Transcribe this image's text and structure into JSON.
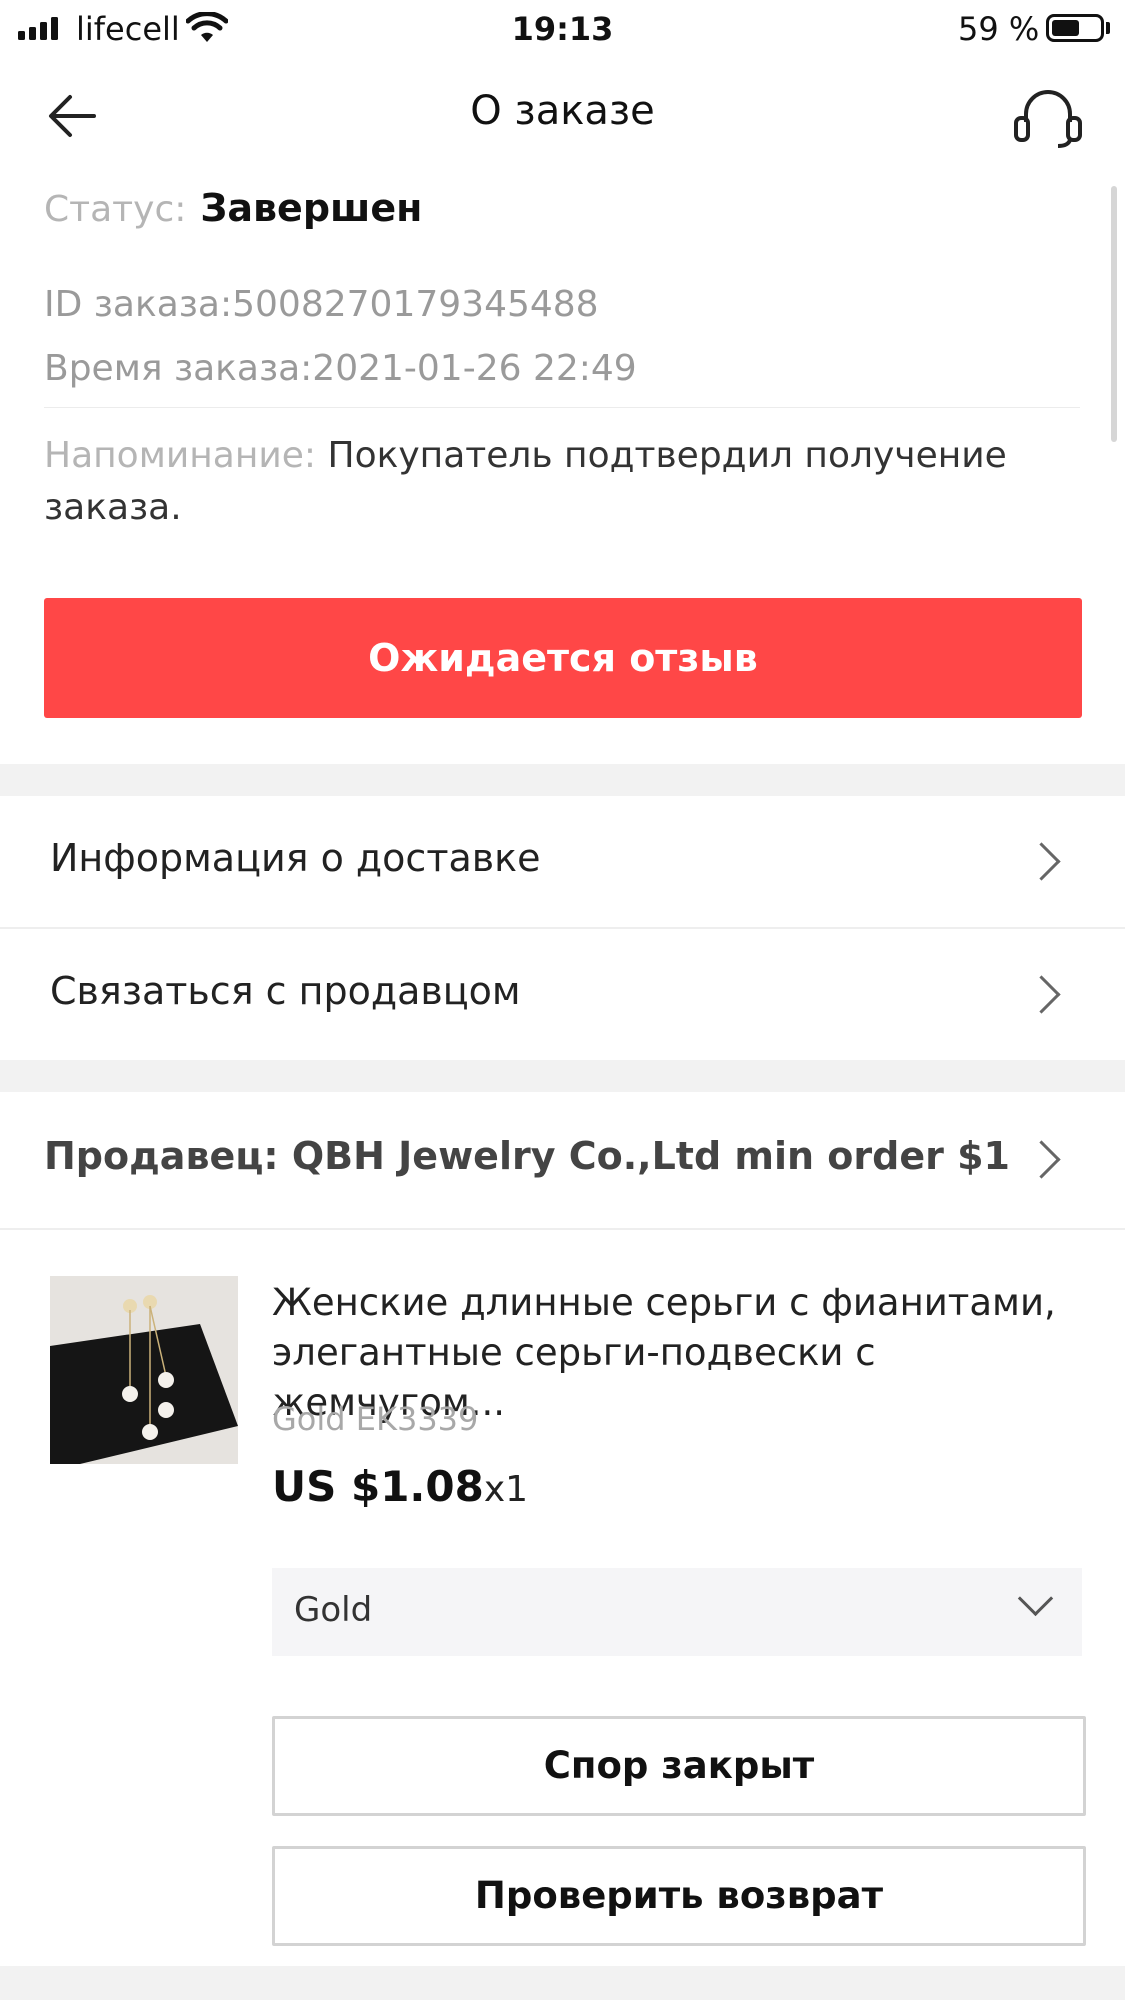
{
  "status_bar": {
    "carrier": "lifecell",
    "time": "19:13",
    "battery": "59 %",
    "battery_level": 0.59
  },
  "header": {
    "title": "О заказе",
    "back_icon": "arrow-left-icon",
    "support_icon": "headset-icon"
  },
  "order": {
    "status_label": "Статус:",
    "status_value": "Завершен",
    "id_line": "ID заказа:5008270179345488",
    "time_line": "Время заказа:2021-01-26 22:49",
    "reminder_label": "Напоминание:",
    "reminder_text": " Покупатель подтвердил получение заказа.",
    "review_button": "Ожидается отзыв"
  },
  "menu": {
    "delivery": "Информация о доставке",
    "contact_seller": "Связаться с продавцом"
  },
  "seller": {
    "label": "Продавец: QBH Jewelry Co.,Ltd min order $1"
  },
  "product": {
    "title": "Женские длинные серьги с фианитами, элегантные серьги-подвески с жемчугом...",
    "sku": "Gold EK3339",
    "price": "US $1.08",
    "quantity": "x1",
    "variant": "Gold",
    "dispute_button": "Спор закрыт",
    "return_button": "Проверить возврат"
  },
  "colors": {
    "accent": "#ff4747",
    "background_band": "#f2f2f2"
  }
}
